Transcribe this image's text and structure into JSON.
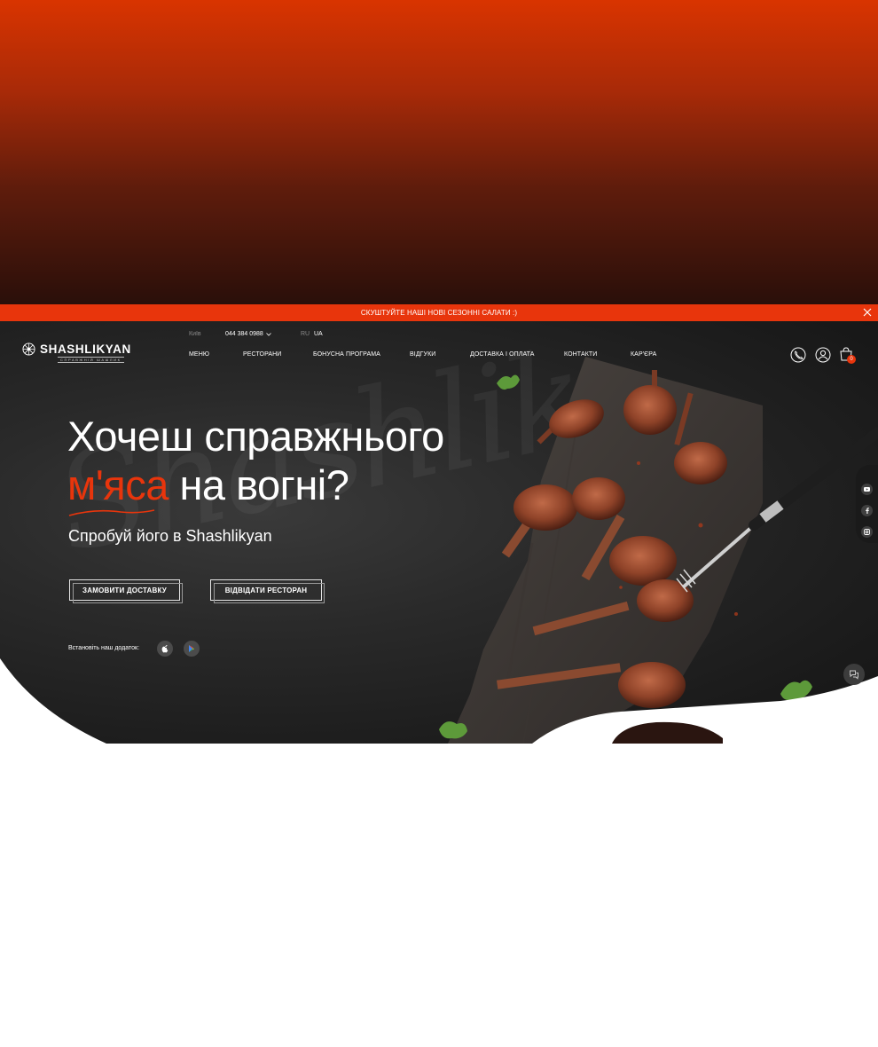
{
  "promo": {
    "text": "СКУШТУЙТЕ НАШІ НОВІ СЕЗОННІ САЛАТИ :)"
  },
  "header": {
    "logo_text": "SHASHLIKYAN",
    "logo_tagline": "СПРАВЖНІЙ ШАШЛИК",
    "city": "Київ",
    "phone": "044 384 0988",
    "lang_ru": "RU",
    "lang_ua": "UA",
    "cart_count": "0"
  },
  "nav": {
    "items": [
      {
        "label": "МЕНЮ"
      },
      {
        "label": "РЕСТОРАНИ"
      },
      {
        "label": "БОНУСНА ПРОГРАМА"
      },
      {
        "label": "ВІДГУКИ"
      },
      {
        "label": "ДОСТАВКА І ОПЛАТА"
      },
      {
        "label": "КОНТАКТИ"
      },
      {
        "label": "КАР'ЄРА"
      }
    ]
  },
  "hero": {
    "headline_line1": "Хочеш справжнього",
    "headline_accent": "м'яса",
    "headline_rest": " на вогні?",
    "subtitle": "Спробуй його в Shashlikyan",
    "btn_delivery": "ЗАМОВИТИ ДОСТАВКУ",
    "btn_restaurant": "ВІДВІДАТИ РЕСТОРАН",
    "app_label": "Встановіть наш додаток:",
    "watermark": "Shashlik"
  },
  "colors": {
    "accent": "#e8350c",
    "hero_bg": "#1c1c1c",
    "top_gradient_start": "#d93400",
    "top_gradient_end": "#2a0f0a"
  },
  "icons": {
    "phone": "phone-icon",
    "profile": "user-icon",
    "cart": "cart-icon",
    "apple": "apple-icon",
    "google_play": "google-play-icon",
    "youtube": "youtube-icon",
    "facebook": "facebook-icon",
    "instagram": "instagram-icon",
    "chat": "chat-icon",
    "close": "close-icon"
  }
}
